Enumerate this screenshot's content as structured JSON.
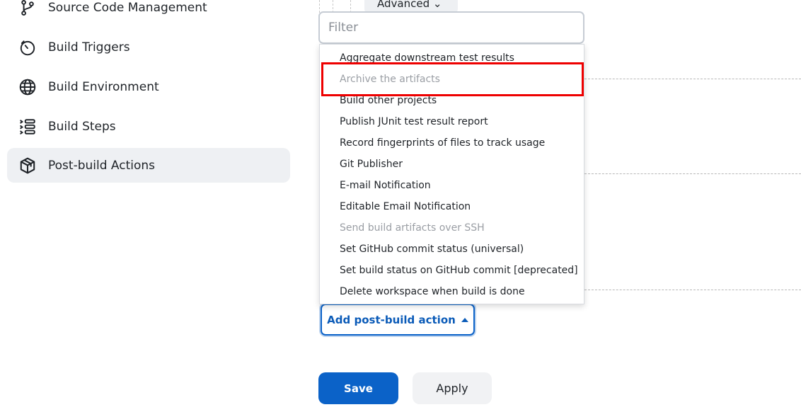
{
  "sidebar": {
    "items": [
      {
        "label": "Source Code Management",
        "icon": "branch-icon",
        "active": false
      },
      {
        "label": "Build Triggers",
        "icon": "timer-icon",
        "active": false
      },
      {
        "label": "Build Environment",
        "icon": "globe-icon",
        "active": false
      },
      {
        "label": "Build Steps",
        "icon": "list-icon",
        "active": false
      },
      {
        "label": "Post-build Actions",
        "icon": "package-icon",
        "active": true
      }
    ]
  },
  "advanced": {
    "label": "Advanced ⌄"
  },
  "filter": {
    "placeholder": "Filter",
    "value": ""
  },
  "dropdown": {
    "items": [
      {
        "label": "Aggregate downstream test results",
        "disabled": false
      },
      {
        "label": "Archive the artifacts",
        "disabled": true
      },
      {
        "label": "Build other projects",
        "disabled": false
      },
      {
        "label": "Publish JUnit test result report",
        "disabled": false
      },
      {
        "label": "Record fingerprints of files to track usage",
        "disabled": false
      },
      {
        "label": "Git Publisher",
        "disabled": false
      },
      {
        "label": "E-mail Notification",
        "disabled": false
      },
      {
        "label": "Editable Email Notification",
        "disabled": false
      },
      {
        "label": "Send build artifacts over SSH",
        "disabled": true
      },
      {
        "label": "Set GitHub commit status (universal)",
        "disabled": false
      },
      {
        "label": "Set build status on GitHub commit [deprecated]",
        "disabled": false
      },
      {
        "label": "Delete workspace when build is done",
        "disabled": false
      }
    ]
  },
  "add_action": {
    "label": "Add post-build action"
  },
  "footer": {
    "save_label": "Save",
    "apply_label": "Apply"
  },
  "colors": {
    "accent": "#0b62c8",
    "highlight": "#ee0000",
    "disabled_text": "#9a9ea4",
    "active_bg": "#eef0f3"
  }
}
